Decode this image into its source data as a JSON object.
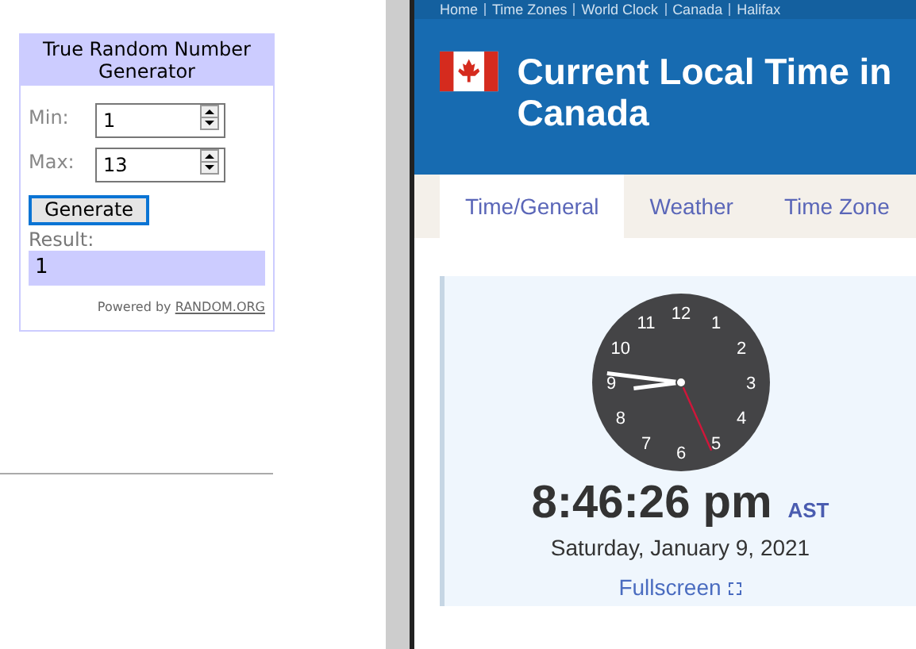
{
  "widget": {
    "title": "True Random Number Generator",
    "fields": [
      {
        "label": "Min:",
        "value": "1"
      },
      {
        "label": "Max:",
        "value": "13"
      }
    ],
    "button": "Generate",
    "result_label": "Result:",
    "result": "1",
    "powered_by": "Powered by",
    "powered_link": "RANDOM.ORG"
  },
  "page": {
    "breadcrumb": [
      "Home",
      "Time Zones",
      "World Clock",
      "Canada",
      "Halifax"
    ],
    "title": "Current Local Time in Canada",
    "tabs": [
      {
        "label": "Time/General",
        "selected": true
      },
      {
        "label": "Weather",
        "selected": false
      },
      {
        "label": "Time Zone",
        "selected": false
      }
    ],
    "clock": {
      "numbers": [
        "12",
        "1",
        "2",
        "3",
        "4",
        "5",
        "6",
        "7",
        "8",
        "9",
        "10",
        "11"
      ],
      "time": "8:46:26 pm",
      "zone": "AST",
      "date": "Saturday, January 9, 2021",
      "fullscreen": "Fullscreen"
    }
  }
}
